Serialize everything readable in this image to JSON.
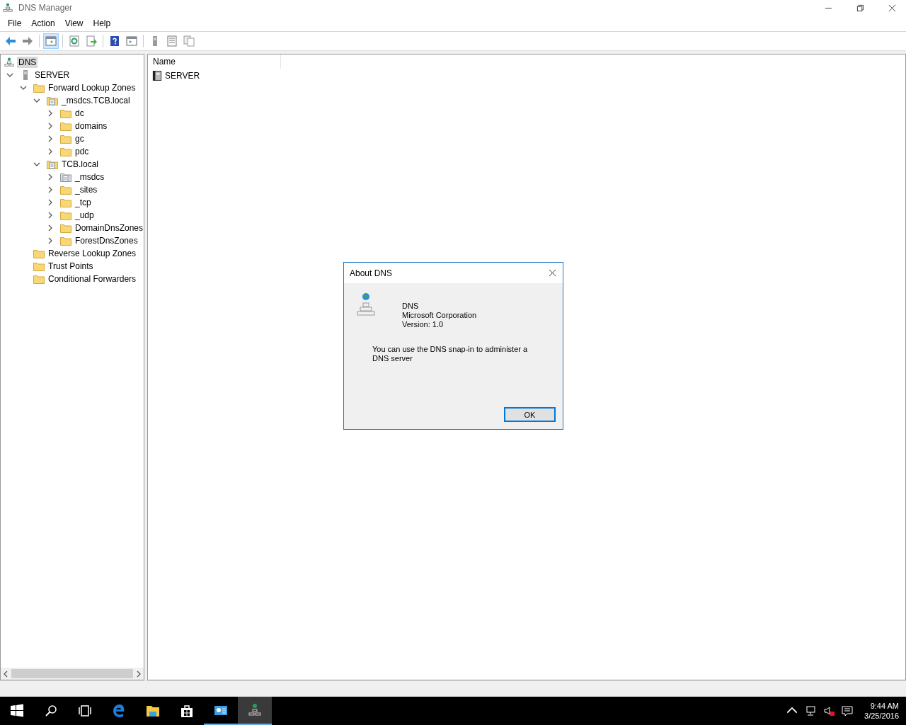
{
  "window": {
    "title": "DNS Manager"
  },
  "menu": [
    "File",
    "Action",
    "View",
    "Help"
  ],
  "toolbar": [
    [
      {
        "kind": "back"
      },
      {
        "kind": "forward"
      }
    ],
    [
      {
        "kind": "tree",
        "pressed": true
      }
    ],
    [
      {
        "kind": "refresh"
      },
      {
        "kind": "export"
      }
    ],
    [
      {
        "kind": "help"
      },
      {
        "kind": "pane"
      }
    ],
    [
      {
        "kind": "server"
      },
      {
        "kind": "list"
      },
      {
        "kind": "copy"
      }
    ]
  ],
  "tree": [
    {
      "label": "DNS",
      "kind": "dns",
      "selected": true,
      "children": [
        {
          "label": "SERVER",
          "kind": "server",
          "selected": false,
          "expanded": true,
          "children": [
            {
              "label": "Forward Lookup Zones",
              "kind": "folder",
              "selected": false,
              "expanded": true,
              "children": [
                {
                  "label": "_msdcs.TCB.local",
                  "kind": "zone",
                  "selected": false,
                  "expanded": true,
                  "children": [
                    {
                      "label": "dc",
                      "kind": "folder",
                      "selected": false,
                      "expanded": false
                    },
                    {
                      "label": "domains",
                      "kind": "folder",
                      "selected": false,
                      "expanded": false
                    },
                    {
                      "label": "gc",
                      "kind": "folder",
                      "selected": false,
                      "expanded": false
                    },
                    {
                      "label": "pdc",
                      "kind": "folder",
                      "selected": false,
                      "expanded": false
                    }
                  ]
                },
                {
                  "label": "TCB.local",
                  "kind": "zone",
                  "selected": false,
                  "expanded": true,
                  "children": [
                    {
                      "label": "_msdcs",
                      "kind": "delegation",
                      "selected": false,
                      "expanded": false
                    },
                    {
                      "label": "_sites",
                      "kind": "folder",
                      "selected": false,
                      "expanded": false
                    },
                    {
                      "label": "_tcp",
                      "kind": "folder",
                      "selected": false,
                      "expanded": false
                    },
                    {
                      "label": "_udp",
                      "kind": "folder",
                      "selected": false,
                      "expanded": false
                    },
                    {
                      "label": "DomainDnsZones",
                      "kind": "folder",
                      "selected": false,
                      "expanded": false
                    },
                    {
                      "label": "ForestDnsZones",
                      "kind": "folder",
                      "selected": false,
                      "expanded": false
                    }
                  ]
                }
              ]
            },
            {
              "label": "Reverse Lookup Zones",
              "kind": "folder",
              "selected": false
            },
            {
              "label": "Trust Points",
              "kind": "folder",
              "selected": false
            },
            {
              "label": "Conditional Forwarders",
              "kind": "folder",
              "selected": false
            }
          ]
        }
      ]
    }
  ],
  "list": {
    "columns": [
      "Name"
    ],
    "rows": [
      {
        "name": "SERVER"
      }
    ]
  },
  "dialog": {
    "title": "About DNS",
    "product": "DNS",
    "company": "Microsoft Corporation",
    "version": "Version: 1.0",
    "description": "You can use the DNS snap-in to administer a DNS server",
    "button": "OK"
  },
  "taskbar": {
    "items": [
      {
        "kind": "start",
        "selected": false
      },
      {
        "kind": "search",
        "selected": false
      },
      {
        "kind": "taskview",
        "selected": false
      },
      {
        "kind": "edge",
        "selected": false
      },
      {
        "kind": "explorer",
        "selected": false
      },
      {
        "kind": "store",
        "selected": false
      },
      {
        "kind": "servermanager",
        "selected": false
      },
      {
        "kind": "dns",
        "selected": true
      }
    ],
    "time": "9:44 AM",
    "date": "3/25/2016"
  }
}
